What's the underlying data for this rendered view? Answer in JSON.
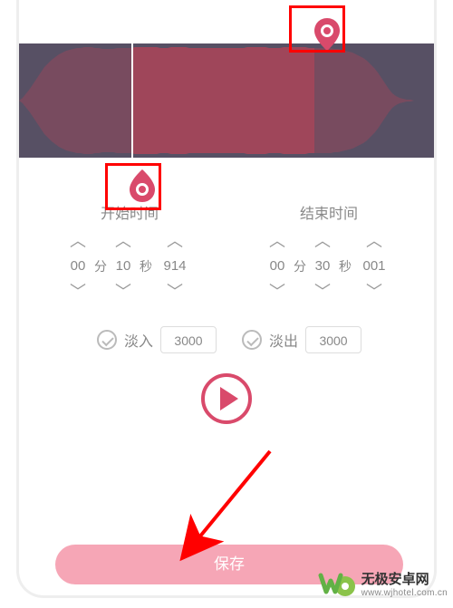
{
  "colors": {
    "accent": "#d94a6b",
    "highlight": "#f00",
    "save_bg": "#f6a6b6",
    "wave_bg": "#575064",
    "wave_fill": "#9f465a"
  },
  "start": {
    "label": "开始时间",
    "minutes": "00",
    "min_unit": "分",
    "seconds": "10",
    "sec_unit": "秒",
    "millis": "914"
  },
  "end": {
    "label": "结束时间",
    "minutes": "00",
    "min_unit": "分",
    "seconds": "30",
    "sec_unit": "秒",
    "millis": "001"
  },
  "fade": {
    "in_label": "淡入",
    "in_value": "3000",
    "out_label": "淡出",
    "out_value": "3000"
  },
  "save_label": "保存",
  "watermark": {
    "title": "无极安卓网",
    "url": "www.wjhotel.com.cn"
  }
}
